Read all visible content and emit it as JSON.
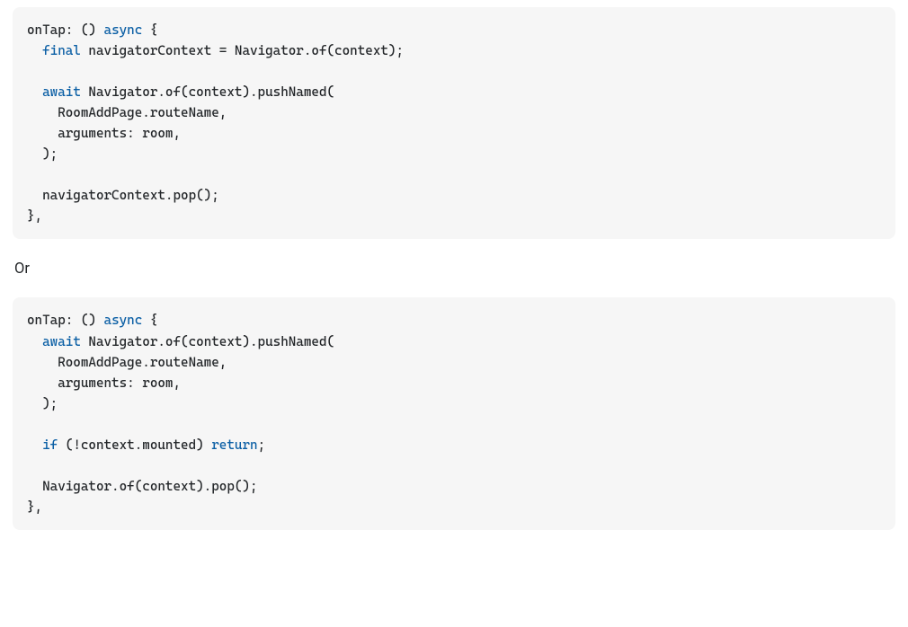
{
  "separator_label": "Or",
  "block1": {
    "lines": [
      [
        {
          "t": "onTap: () "
        },
        {
          "t": "async",
          "kw": true
        },
        {
          "t": " {"
        }
      ],
      [
        {
          "t": "  "
        },
        {
          "t": "final",
          "kw": true
        },
        {
          "t": " navigatorContext = Navigator.of(context);"
        }
      ],
      [
        {
          "t": ""
        }
      ],
      [
        {
          "t": "  "
        },
        {
          "t": "await",
          "kw": true
        },
        {
          "t": " Navigator.of(context).pushNamed("
        }
      ],
      [
        {
          "t": "    RoomAddPage.routeName,"
        }
      ],
      [
        {
          "t": "    arguments: room,"
        }
      ],
      [
        {
          "t": "  );"
        }
      ],
      [
        {
          "t": ""
        }
      ],
      [
        {
          "t": "  navigatorContext.pop();"
        }
      ],
      [
        {
          "t": "},"
        }
      ]
    ]
  },
  "block2": {
    "lines": [
      [
        {
          "t": "onTap: () "
        },
        {
          "t": "async",
          "kw": true
        },
        {
          "t": " {"
        }
      ],
      [
        {
          "t": "  "
        },
        {
          "t": "await",
          "kw": true
        },
        {
          "t": " Navigator.of(context).pushNamed("
        }
      ],
      [
        {
          "t": "    RoomAddPage.routeName,"
        }
      ],
      [
        {
          "t": "    arguments: room,"
        }
      ],
      [
        {
          "t": "  );"
        }
      ],
      [
        {
          "t": ""
        }
      ],
      [
        {
          "t": "  "
        },
        {
          "t": "if",
          "kw": true
        },
        {
          "t": " (!context.mounted) "
        },
        {
          "t": "return",
          "kw": true
        },
        {
          "t": ";"
        }
      ],
      [
        {
          "t": ""
        }
      ],
      [
        {
          "t": "  Navigator.of(context).pop();"
        }
      ],
      [
        {
          "t": "},"
        }
      ]
    ]
  }
}
